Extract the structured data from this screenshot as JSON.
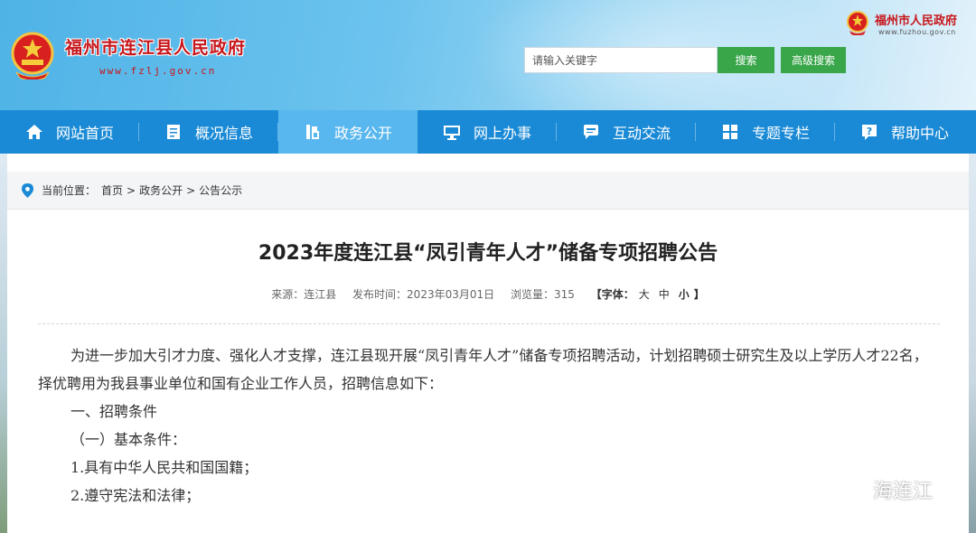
{
  "header": {
    "site_title": "福州市连江县人民政府",
    "site_url": "www.fzlj.gov.cn",
    "parent_site_title": "福州市人民政府",
    "parent_site_url": "www.fuzhou.gov.cn",
    "search_placeholder": "请输入关键字",
    "search_button": "搜索",
    "advanced_search_button": "高级搜索"
  },
  "nav": {
    "items": [
      {
        "label": "网站首页",
        "icon": "home-icon"
      },
      {
        "label": "概况信息",
        "icon": "document-icon"
      },
      {
        "label": "政务公开",
        "icon": "open-affairs-icon",
        "active": true
      },
      {
        "label": "网上办事",
        "icon": "monitor-icon"
      },
      {
        "label": "互动交流",
        "icon": "chat-icon"
      },
      {
        "label": "专题专栏",
        "icon": "grid-icon"
      },
      {
        "label": "帮助中心",
        "icon": "help-icon"
      }
    ]
  },
  "breadcrumb": {
    "prefix": "当前位置：",
    "items": [
      "首页",
      "政务公开",
      "公告公示"
    ],
    "separator": ">"
  },
  "article": {
    "title": "2023年度连江县“凤引青年人才”储备专项招聘公告",
    "source": "来源：连江县",
    "publish_time": "发布时间：2023年03月01日",
    "views": "浏览量：315",
    "font_size_label": "【字体：",
    "font_large": "大",
    "font_medium": "中",
    "font_small": "小",
    "font_close": "】",
    "paragraphs": {
      "intro": "为进一步加大引才力度、强化人才支撑，连江县现开展“凤引青年人才”储备专项招聘活动，计划招聘硕士研究生及以上学历人才22名，择优聘用为我县事业单位和国有企业工作人员，招聘信息如下：",
      "section1": "一、招聘条件",
      "sub1": "（一）基本条件：",
      "item1": "1.具有中华人民共和国国籍；",
      "item2": "2.遵守宪法和法律；"
    }
  },
  "watermark": "海连江",
  "colors": {
    "nav_bg": "#1a8ad6",
    "nav_active": "#58b7ee",
    "brand_red": "#c7161b",
    "button_green": "#39a64a"
  }
}
